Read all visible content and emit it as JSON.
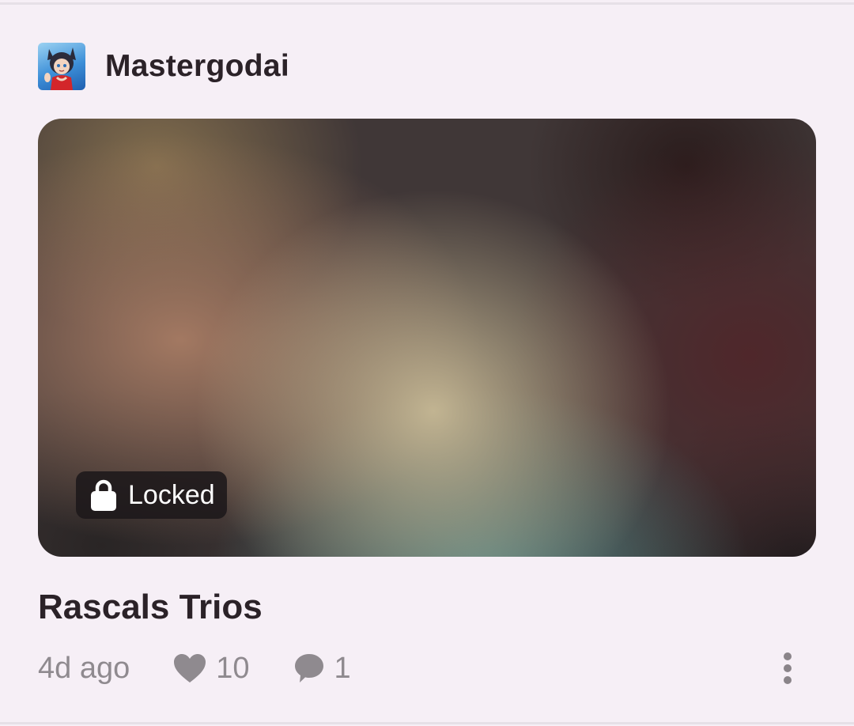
{
  "post": {
    "author": "Mastergodai",
    "badge": "Locked",
    "title": "Rascals Trios",
    "time": "4d ago",
    "likes": "10",
    "comments": "1"
  },
  "icons": {
    "avatar": "anime-character-avatar",
    "lock": "lock-icon",
    "like": "heart-icon",
    "comment": "comment-bubble-icon",
    "menu": "more-vertical-icon"
  },
  "colors": {
    "background": "#f6eff6",
    "text": "#2b2228",
    "muted": "#8f8a8f",
    "badge": "#1c181a"
  }
}
